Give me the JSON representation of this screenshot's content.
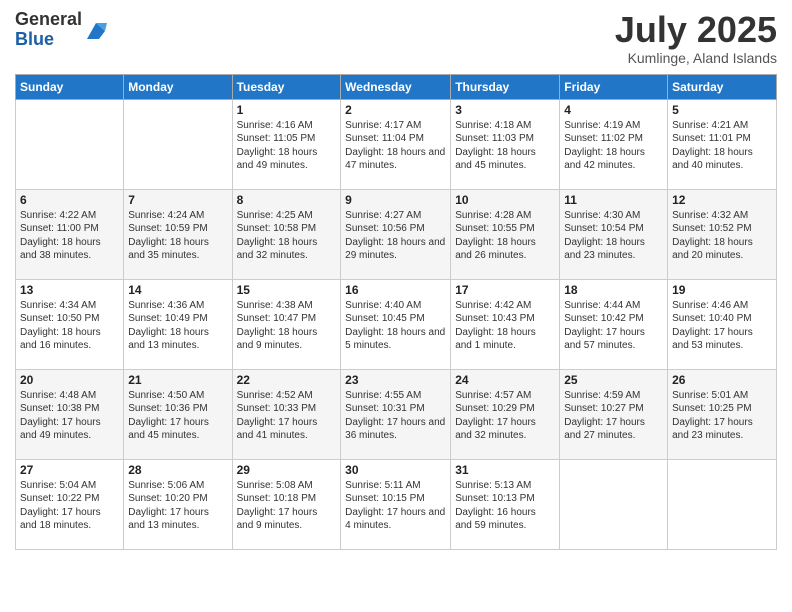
{
  "logo": {
    "general": "General",
    "blue": "Blue"
  },
  "title": "July 2025",
  "subtitle": "Kumlinge, Aland Islands",
  "days_of_week": [
    "Sunday",
    "Monday",
    "Tuesday",
    "Wednesday",
    "Thursday",
    "Friday",
    "Saturday"
  ],
  "weeks": [
    [
      {
        "day": "",
        "info": ""
      },
      {
        "day": "",
        "info": ""
      },
      {
        "day": "1",
        "info": "Sunrise: 4:16 AM\nSunset: 11:05 PM\nDaylight: 18 hours and 49 minutes."
      },
      {
        "day": "2",
        "info": "Sunrise: 4:17 AM\nSunset: 11:04 PM\nDaylight: 18 hours and 47 minutes."
      },
      {
        "day": "3",
        "info": "Sunrise: 4:18 AM\nSunset: 11:03 PM\nDaylight: 18 hours and 45 minutes."
      },
      {
        "day": "4",
        "info": "Sunrise: 4:19 AM\nSunset: 11:02 PM\nDaylight: 18 hours and 42 minutes."
      },
      {
        "day": "5",
        "info": "Sunrise: 4:21 AM\nSunset: 11:01 PM\nDaylight: 18 hours and 40 minutes."
      }
    ],
    [
      {
        "day": "6",
        "info": "Sunrise: 4:22 AM\nSunset: 11:00 PM\nDaylight: 18 hours and 38 minutes."
      },
      {
        "day": "7",
        "info": "Sunrise: 4:24 AM\nSunset: 10:59 PM\nDaylight: 18 hours and 35 minutes."
      },
      {
        "day": "8",
        "info": "Sunrise: 4:25 AM\nSunset: 10:58 PM\nDaylight: 18 hours and 32 minutes."
      },
      {
        "day": "9",
        "info": "Sunrise: 4:27 AM\nSunset: 10:56 PM\nDaylight: 18 hours and 29 minutes."
      },
      {
        "day": "10",
        "info": "Sunrise: 4:28 AM\nSunset: 10:55 PM\nDaylight: 18 hours and 26 minutes."
      },
      {
        "day": "11",
        "info": "Sunrise: 4:30 AM\nSunset: 10:54 PM\nDaylight: 18 hours and 23 minutes."
      },
      {
        "day": "12",
        "info": "Sunrise: 4:32 AM\nSunset: 10:52 PM\nDaylight: 18 hours and 20 minutes."
      }
    ],
    [
      {
        "day": "13",
        "info": "Sunrise: 4:34 AM\nSunset: 10:50 PM\nDaylight: 18 hours and 16 minutes."
      },
      {
        "day": "14",
        "info": "Sunrise: 4:36 AM\nSunset: 10:49 PM\nDaylight: 18 hours and 13 minutes."
      },
      {
        "day": "15",
        "info": "Sunrise: 4:38 AM\nSunset: 10:47 PM\nDaylight: 18 hours and 9 minutes."
      },
      {
        "day": "16",
        "info": "Sunrise: 4:40 AM\nSunset: 10:45 PM\nDaylight: 18 hours and 5 minutes."
      },
      {
        "day": "17",
        "info": "Sunrise: 4:42 AM\nSunset: 10:43 PM\nDaylight: 18 hours and 1 minute."
      },
      {
        "day": "18",
        "info": "Sunrise: 4:44 AM\nSunset: 10:42 PM\nDaylight: 17 hours and 57 minutes."
      },
      {
        "day": "19",
        "info": "Sunrise: 4:46 AM\nSunset: 10:40 PM\nDaylight: 17 hours and 53 minutes."
      }
    ],
    [
      {
        "day": "20",
        "info": "Sunrise: 4:48 AM\nSunset: 10:38 PM\nDaylight: 17 hours and 49 minutes."
      },
      {
        "day": "21",
        "info": "Sunrise: 4:50 AM\nSunset: 10:36 PM\nDaylight: 17 hours and 45 minutes."
      },
      {
        "day": "22",
        "info": "Sunrise: 4:52 AM\nSunset: 10:33 PM\nDaylight: 17 hours and 41 minutes."
      },
      {
        "day": "23",
        "info": "Sunrise: 4:55 AM\nSunset: 10:31 PM\nDaylight: 17 hours and 36 minutes."
      },
      {
        "day": "24",
        "info": "Sunrise: 4:57 AM\nSunset: 10:29 PM\nDaylight: 17 hours and 32 minutes."
      },
      {
        "day": "25",
        "info": "Sunrise: 4:59 AM\nSunset: 10:27 PM\nDaylight: 17 hours and 27 minutes."
      },
      {
        "day": "26",
        "info": "Sunrise: 5:01 AM\nSunset: 10:25 PM\nDaylight: 17 hours and 23 minutes."
      }
    ],
    [
      {
        "day": "27",
        "info": "Sunrise: 5:04 AM\nSunset: 10:22 PM\nDaylight: 17 hours and 18 minutes."
      },
      {
        "day": "28",
        "info": "Sunrise: 5:06 AM\nSunset: 10:20 PM\nDaylight: 17 hours and 13 minutes."
      },
      {
        "day": "29",
        "info": "Sunrise: 5:08 AM\nSunset: 10:18 PM\nDaylight: 17 hours and 9 minutes."
      },
      {
        "day": "30",
        "info": "Sunrise: 5:11 AM\nSunset: 10:15 PM\nDaylight: 17 hours and 4 minutes."
      },
      {
        "day": "31",
        "info": "Sunrise: 5:13 AM\nSunset: 10:13 PM\nDaylight: 16 hours and 59 minutes."
      },
      {
        "day": "",
        "info": ""
      },
      {
        "day": "",
        "info": ""
      }
    ]
  ]
}
